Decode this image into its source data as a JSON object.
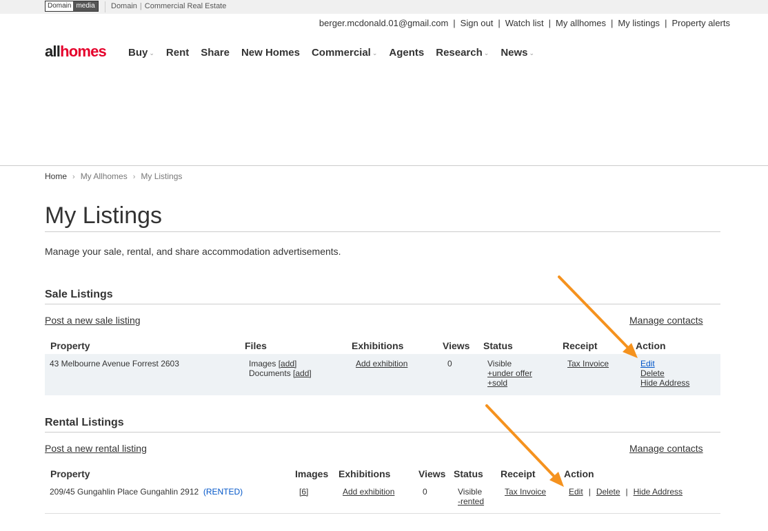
{
  "topstrip": {
    "logo_a": "Domain",
    "logo_b": "media",
    "link_domain": "Domain",
    "separator": "|",
    "link_commercial": "Commercial Real Estate"
  },
  "account": {
    "email": "berger.mcdonald.01@gmail.com",
    "sign_out": "Sign out",
    "watch_list": "Watch list",
    "my_allhomes": "My allhomes",
    "my_listings": "My listings",
    "property_alerts": "Property alerts",
    "separator": "|"
  },
  "logo": {
    "part1": "all",
    "part2": "homes"
  },
  "nav": {
    "buy": "Buy",
    "rent": "Rent",
    "share": "Share",
    "new_homes": "New Homes",
    "commercial": "Commercial",
    "agents": "Agents",
    "research": "Research",
    "news": "News"
  },
  "breadcrumb": {
    "home": "Home",
    "my_allhomes": "My Allhomes",
    "my_listings": "My Listings"
  },
  "page": {
    "title": "My Listings",
    "intro": "Manage your sale, rental, and share accommodation advertisements."
  },
  "sale": {
    "title": "Sale Listings",
    "post_link": "Post a new sale listing",
    "manage_contacts": "Manage contacts",
    "headers": {
      "property": "Property",
      "files": "Files",
      "exhibitions": "Exhibitions",
      "views": "Views",
      "status": "Status",
      "receipt": "Receipt",
      "action": "Action"
    },
    "row": {
      "property": "43 Melbourne Avenue Forrest 2603",
      "images_label": "Images",
      "documents_label": "Documents",
      "add_link": "[add]",
      "add_exhibition": "Add exhibition",
      "views": "0",
      "status": "Visible",
      "under_offer": "+under offer",
      "sold": "+sold",
      "receipt": "Tax Invoice",
      "edit": "Edit",
      "delete": "Delete",
      "hide_address": "Hide Address"
    }
  },
  "rental": {
    "title": "Rental Listings",
    "post_link": "Post a new rental listing",
    "manage_contacts": "Manage contacts",
    "headers": {
      "property": "Property",
      "images": "Images",
      "exhibitions": "Exhibitions",
      "views": "Views",
      "status": "Status",
      "receipt": "Receipt",
      "action": "Action"
    },
    "row": {
      "property": "209/45 Gungahlin Place Gungahlin 2912",
      "rented_badge": "(RENTED)",
      "images": "[6]",
      "add_exhibition": "Add exhibition",
      "views": "0",
      "status": "Visible",
      "rented": "-rented",
      "receipt": "Tax Invoice",
      "edit": "Edit",
      "delete": "Delete",
      "hide_address": "Hide Address",
      "separator": "|"
    }
  },
  "colors": {
    "brand_red": "#e5002b",
    "link_blue": "#0055c8",
    "annotation_orange": "#f5921e",
    "row_background": "#eef2f5"
  }
}
